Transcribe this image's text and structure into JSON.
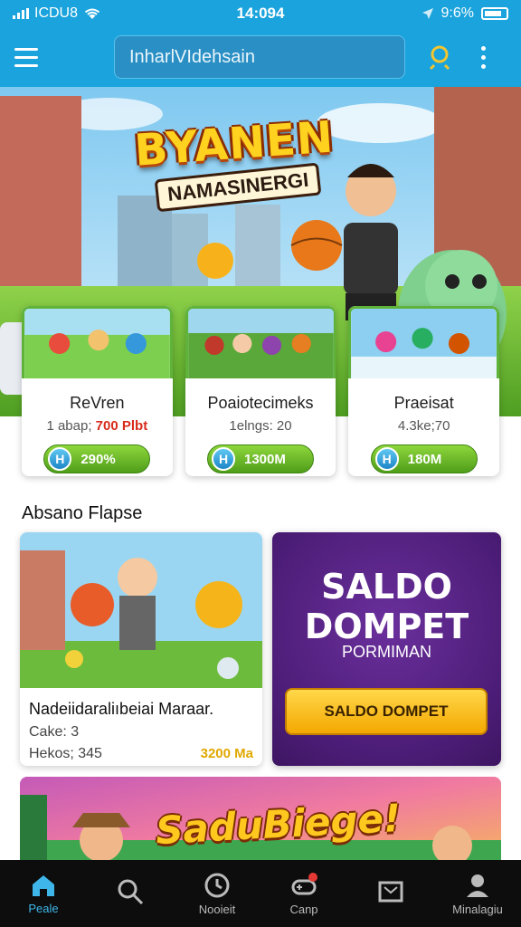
{
  "status_bar": {
    "carrier": "ICDU8",
    "time": "14:094",
    "battery": "9:6%"
  },
  "header": {
    "search_value": "InharlVIdehsain"
  },
  "hero": {
    "title": "BYANEN",
    "subtitle": "NAMASINERGI"
  },
  "game_cards": [
    {
      "title": "ReVren",
      "sub_prefix": "1 abap;",
      "price": "700 Plbt",
      "button": "290%"
    },
    {
      "title": "Poaiotecimeks",
      "sub_prefix": "1elngs: 20",
      "price": "",
      "button": "1300M"
    },
    {
      "title": "Praeisat",
      "sub_prefix": "4.3ke;70",
      "price": "",
      "button": "180M"
    }
  ],
  "section": {
    "title": "Absano Flapse"
  },
  "featured": {
    "title": "Nadeiidaraliıbeiai Maraar.",
    "line1": "Cake: 3",
    "line2": "Hekos; 345",
    "amount": "3200 Ma"
  },
  "promo": {
    "heading_line1": "SALDO",
    "heading_line2": "DOMPET",
    "subheading": "PORMIMAN",
    "button": "SALDO DOMPET"
  },
  "banner": {
    "title": "SaduBiege!"
  },
  "bottom_nav": [
    {
      "label": "Peale",
      "icon": "home-icon",
      "active": true
    },
    {
      "label": "",
      "icon": "search-icon",
      "active": false
    },
    {
      "label": "Nooieit",
      "icon": "clock-icon",
      "active": false
    },
    {
      "label": "Canp",
      "icon": "gamepad-icon",
      "active": false
    },
    {
      "label": "",
      "icon": "inbox-icon",
      "active": false
    },
    {
      "label": "Minalagiu",
      "icon": "profile-icon",
      "active": false
    }
  ],
  "colors": {
    "primary": "#1aa3dc",
    "accent_green": "#5fb33a",
    "promo_purple": "#4c1d77",
    "promo_button": "#f4b400",
    "nav_active": "#3eb6ea"
  }
}
